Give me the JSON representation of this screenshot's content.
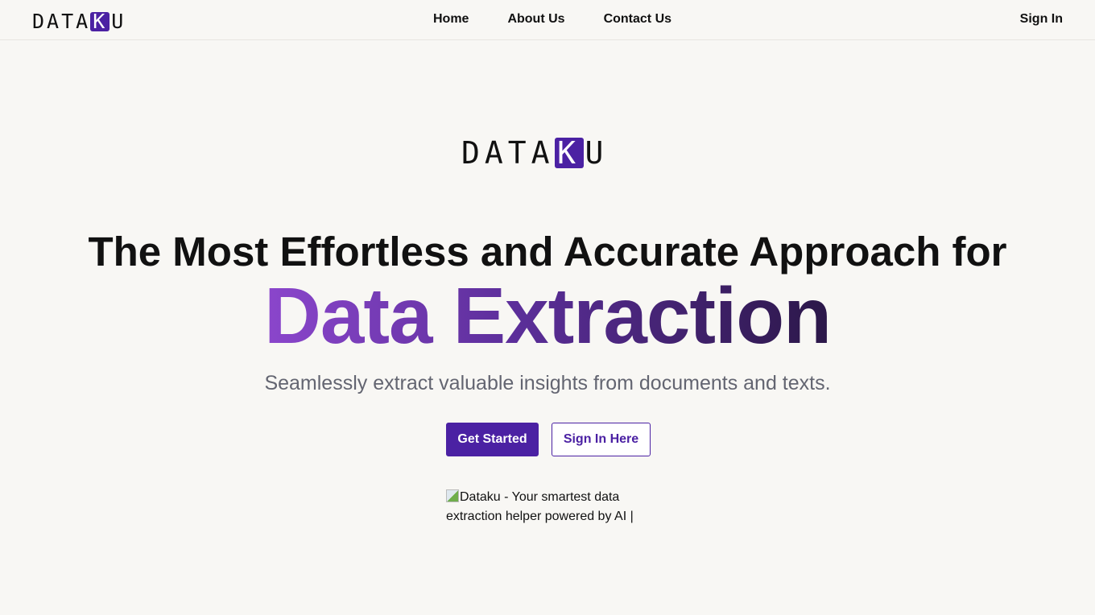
{
  "brand": {
    "prefix": "DATA",
    "highlight": "K",
    "suffix": "U",
    "accent_color": "#4b21a3"
  },
  "nav": {
    "links": [
      {
        "label": "Home"
      },
      {
        "label": "About Us"
      },
      {
        "label": "Contact Us"
      }
    ],
    "signin_label": "Sign In"
  },
  "hero": {
    "headline": "The Most Effortless and Accurate Approach for",
    "highlight": "Data Extraction",
    "subtitle": "Seamlessly extract valuable insights from documents and texts.",
    "primary_button": "Get Started",
    "secondary_button": "Sign In Here",
    "image_alt": "Dataku - Your smartest data extraction helper powered by AI | Dataku"
  }
}
